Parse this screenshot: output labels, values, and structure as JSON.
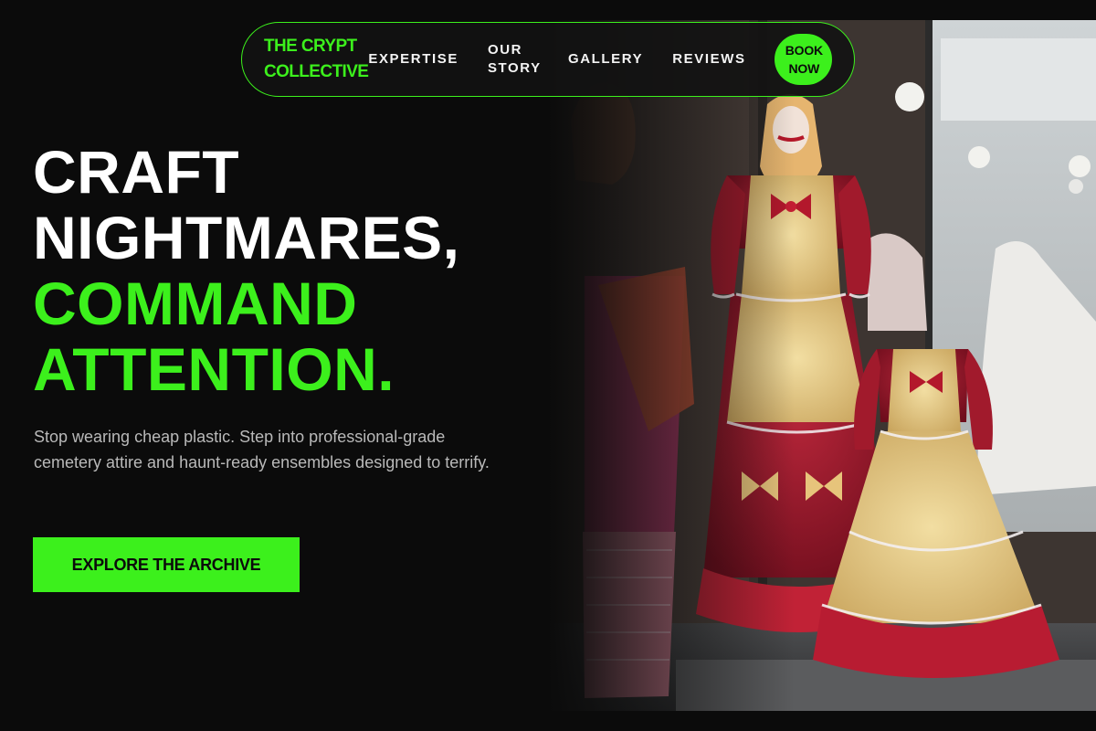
{
  "brand": {
    "line1": "THE CRYPT",
    "line2": "COLLECTIVE"
  },
  "nav": {
    "expertise": "EXPERTISE",
    "our_story": "OUR STORY",
    "gallery": "GALLERY",
    "reviews": "REVIEWS",
    "book_line1": "BOOK",
    "book_line2": "NOW"
  },
  "hero": {
    "headline_line1": "CRAFT",
    "headline_line2": "NIGHTMARES,",
    "headline_line3": "COMMAND",
    "headline_line4": "ATTENTION.",
    "lede": "Stop wearing cheap plastic. Step into professional-grade cemetery attire and haunt-ready ensembles designed to terrify.",
    "cta_label": "EXPLORE THE ARCHIVE"
  },
  "colors": {
    "accent": "#3cf01c",
    "background": "#0b0b0b",
    "text": "#ffffff",
    "muted_text": "#b9b9b9"
  }
}
